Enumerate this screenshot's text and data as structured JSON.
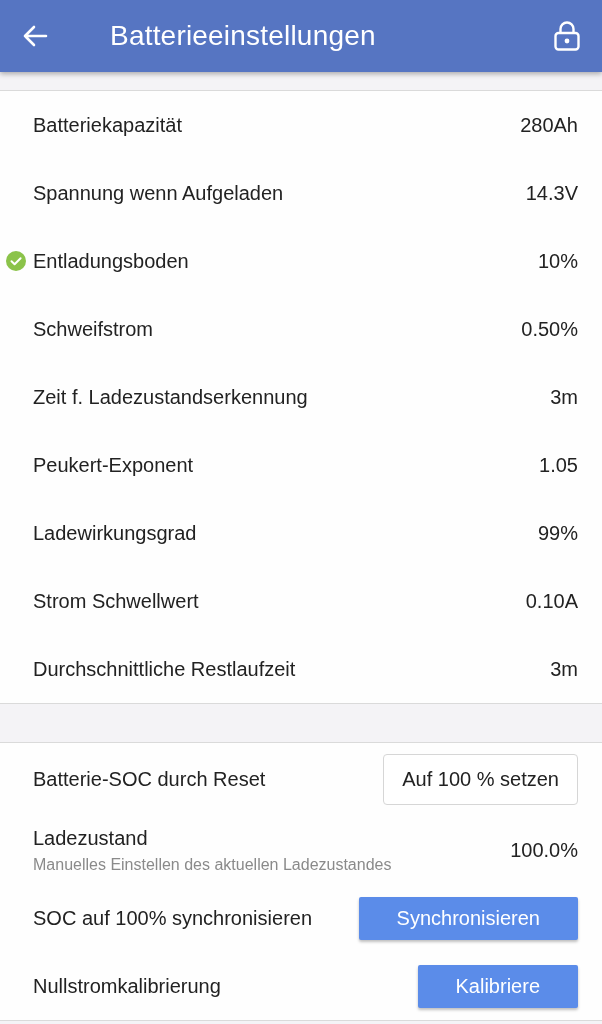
{
  "header": {
    "title": "Batterieeinstellungen"
  },
  "settings": [
    {
      "label": "Batteriekapazität",
      "value": "280Ah",
      "confirmed": false
    },
    {
      "label": "Spannung wenn Aufgeladen",
      "value": "14.3V",
      "confirmed": false
    },
    {
      "label": "Entladungsboden",
      "value": "10%",
      "confirmed": true
    },
    {
      "label": "Schweifstrom",
      "value": "0.50%",
      "confirmed": false
    },
    {
      "label": "Zeit f. Ladezustandserkennung",
      "value": "3m",
      "confirmed": false
    },
    {
      "label": "Peukert-Exponent",
      "value": "1.05",
      "confirmed": false
    },
    {
      "label": "Ladewirkungsgrad",
      "value": "99%",
      "confirmed": false
    },
    {
      "label": "Strom Schwellwert",
      "value": "0.10A",
      "confirmed": false
    },
    {
      "label": "Durchschnittliche Restlaufzeit",
      "value": "3m",
      "confirmed": false
    }
  ],
  "actions": [
    {
      "kind": "outlined",
      "label": "Batterie-SOC durch Reset",
      "button": "Auf 100 % setzen"
    },
    {
      "kind": "value",
      "label": "Ladezustand",
      "description": "Manuelles Einstellen des aktuellen Ladezustandes",
      "value": "100.0%"
    },
    {
      "kind": "primary",
      "label": "SOC auf 100% synchronisieren",
      "button": "Synchronisieren"
    },
    {
      "kind": "primary",
      "label": "Nullstromkalibrierung",
      "button": "Kalibriere"
    }
  ]
}
